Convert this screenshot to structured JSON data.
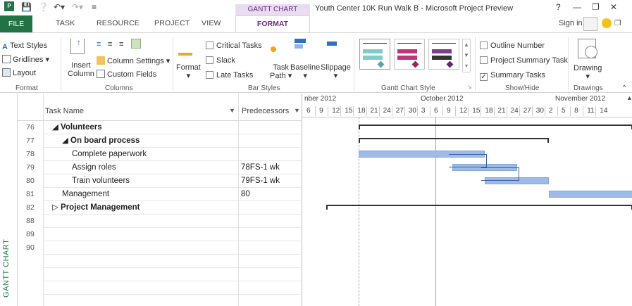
{
  "window": {
    "title": "Youth Center 10K Run Walk B - Microsoft Project Preview",
    "context_tab_group": "GANTT CHART TOOLS"
  },
  "tabs": [
    "FILE",
    "TASK",
    "RESOURCE",
    "PROJECT",
    "VIEW",
    "FORMAT"
  ],
  "account": {
    "sign_in": "Sign in"
  },
  "ribbon": {
    "format_group": {
      "text_styles": "Text Styles",
      "gridlines": "Gridlines",
      "layout": "Layout",
      "label": "Format"
    },
    "columns_group": {
      "insert_column_1": "Insert",
      "insert_column_2": "Column",
      "column_settings": "Column Settings",
      "custom_fields": "Custom Fields",
      "label": "Columns"
    },
    "bar_styles_group": {
      "format": "Format",
      "critical_tasks": "Critical Tasks",
      "slack": "Slack",
      "late_tasks": "Late Tasks",
      "task_path_1": "Task",
      "task_path_2": "Path",
      "baseline": "Baseline",
      "slippage": "Slippage",
      "label": "Bar Styles"
    },
    "gantt_style_group": {
      "label": "Gantt Chart Style",
      "styles": [
        {
          "bar": "#7fcccb",
          "diamond": "#5aa3a1"
        },
        {
          "bar": "#c0357a",
          "diamond": "#8e2459"
        },
        {
          "bar": "#7a3f8e",
          "diamond": "#5b2c6a"
        }
      ]
    },
    "show_hide_group": {
      "outline_number": "Outline Number",
      "project_summary_task": "Project Summary Task",
      "summary_tasks": "Summary Tasks",
      "label": "Show/Hide"
    },
    "drawings_group": {
      "drawing": "Drawing",
      "label": "Drawings"
    }
  },
  "grid": {
    "headers": {
      "task_name": "Task Name",
      "predecessors": "Predecessors"
    },
    "rows": [
      {
        "id": "76",
        "name": "◢ Volunteers",
        "pred": "",
        "bold": true,
        "indent": 0
      },
      {
        "id": "77",
        "name": "◢ On board process",
        "pred": "",
        "bold": true,
        "indent": 1
      },
      {
        "id": "78",
        "name": "Complete paperwork",
        "pred": "",
        "bold": false,
        "indent": 2
      },
      {
        "id": "79",
        "name": "Assign roles",
        "pred": "78FS-1 wk",
        "bold": false,
        "indent": 2
      },
      {
        "id": "80",
        "name": "Train volunteers",
        "pred": "79FS-1 wk",
        "bold": false,
        "indent": 2
      },
      {
        "id": "81",
        "name": "Management",
        "pred": "80",
        "bold": false,
        "indent": 1
      },
      {
        "id": "82",
        "name": "▷ Project Management",
        "pred": "",
        "bold": true,
        "indent": 0
      },
      {
        "id": "88",
        "name": "",
        "pred": "",
        "bold": false,
        "indent": 0
      },
      {
        "id": "89",
        "name": "",
        "pred": "",
        "bold": false,
        "indent": 0
      },
      {
        "id": "90",
        "name": "",
        "pred": "",
        "bold": false,
        "indent": 0
      },
      {
        "id": "",
        "name": "",
        "pred": "",
        "bold": false,
        "indent": 0
      },
      {
        "id": "",
        "name": "",
        "pred": "",
        "bold": false,
        "indent": 0
      },
      {
        "id": "",
        "name": "",
        "pred": "",
        "bold": false,
        "indent": 0
      },
      {
        "id": "",
        "name": "",
        "pred": "",
        "bold": false,
        "indent": 0
      }
    ]
  },
  "timescale": {
    "months": [
      "nber 2012",
      "October 2012",
      "November 2012"
    ],
    "days": [
      "6",
      "9",
      "12",
      "15",
      "18",
      "21",
      "24",
      "27",
      "30",
      "3",
      "6",
      "9",
      "12",
      "15",
      "18",
      "21",
      "24",
      "27",
      "30",
      "2",
      "5",
      "8",
      "11",
      "14"
    ]
  },
  "view_label": "GANTT CHART"
}
